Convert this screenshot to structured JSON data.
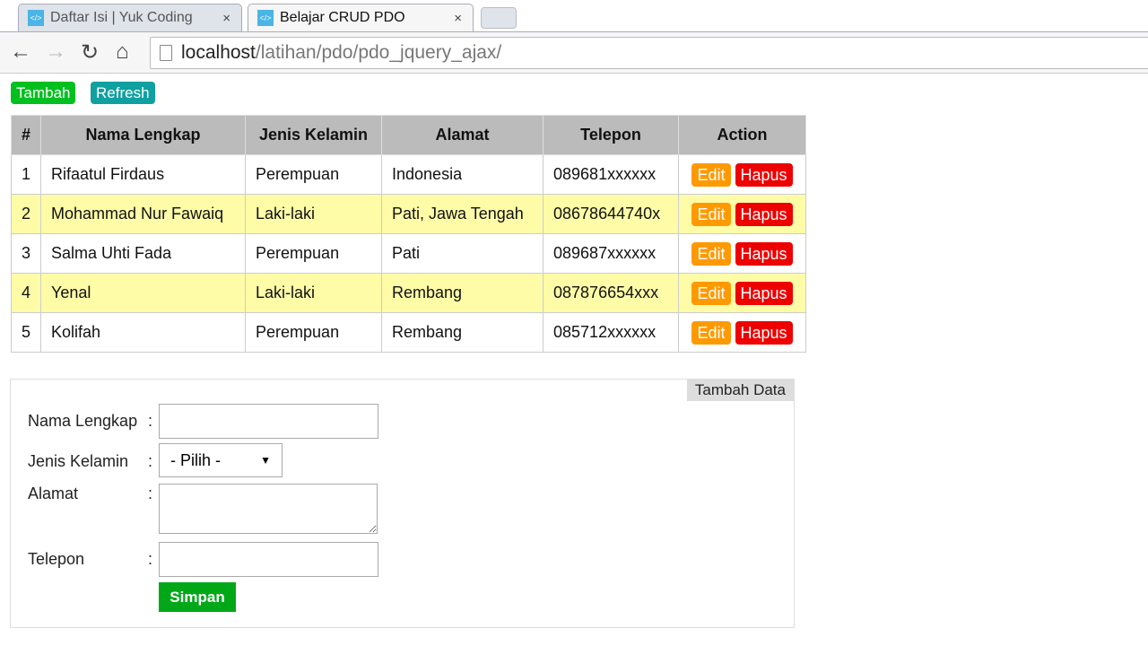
{
  "browser": {
    "tabs": [
      {
        "title": "Daftar Isi | Yuk Coding",
        "favicon": "</>"
      },
      {
        "title": "Belajar CRUD PDO",
        "favicon": "</>"
      }
    ],
    "close_glyph": "×",
    "url_host": "localhost",
    "url_path": "/latihan/pdo/pdo_jquery_ajax/"
  },
  "toolbar": {
    "tambah": "Tambah",
    "refresh": "Refresh"
  },
  "table": {
    "headers": [
      "#",
      "Nama Lengkap",
      "Jenis Kelamin",
      "Alamat",
      "Telepon",
      "Action"
    ],
    "rows": [
      [
        "1",
        "Rifaatul Firdaus",
        "Perempuan",
        "Indonesia",
        "089681xxxxxx"
      ],
      [
        "2",
        "Mohammad Nur Fawaiq",
        "Laki-laki",
        "Pati, Jawa Tengah",
        "08678644740x"
      ],
      [
        "3",
        "Salma Uhti Fada",
        "Perempuan",
        "Pati",
        "089687xxxxxx"
      ],
      [
        "4",
        "Yenal",
        "Laki-laki",
        "Rembang",
        "087876654xxx"
      ],
      [
        "5",
        "Kolifah",
        "Perempuan",
        "Rembang",
        "085712xxxxxx"
      ]
    ],
    "edit": "Edit",
    "hapus": "Hapus"
  },
  "form": {
    "title": "Tambah Data",
    "nama_label": "Nama Lengkap",
    "jk_label": "Jenis Kelamin",
    "alamat_label": "Alamat",
    "telepon_label": "Telepon",
    "colon": ":",
    "select_value": "- Pilih -",
    "simpan": "Simpan"
  },
  "colors": {
    "green": "#00c020",
    "teal": "#10a0a0",
    "orange": "#ff9900",
    "red": "#ee0000",
    "row_alt": "#fffca8",
    "simpan": "#00a818"
  }
}
